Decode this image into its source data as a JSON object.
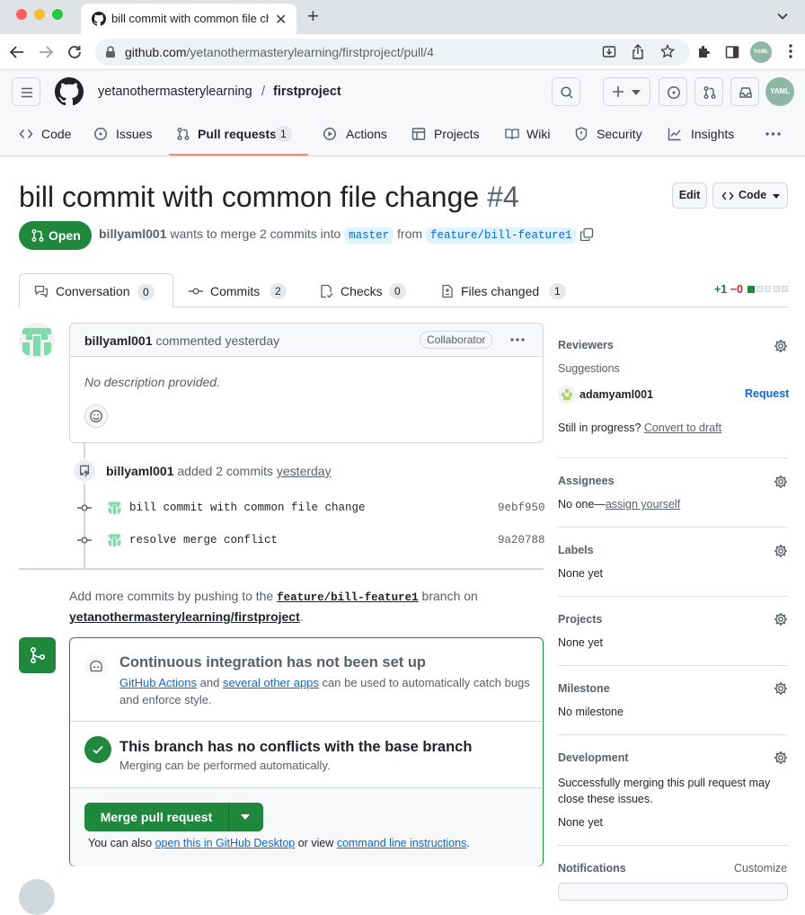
{
  "browser": {
    "tab_title": "bill commit with common file change",
    "url_host": "github.com",
    "url_path": "/yetanothermasterylearning/firstproject/pull/4",
    "profile_initials": "YAML"
  },
  "header": {
    "owner": "yetanothermasterylearning",
    "separator": "/",
    "repo": "firstproject",
    "avatar_initials": "YAML"
  },
  "repo_nav": [
    {
      "label": "Code"
    },
    {
      "label": "Issues"
    },
    {
      "label": "Pull requests",
      "count": "1"
    },
    {
      "label": "Actions"
    },
    {
      "label": "Projects"
    },
    {
      "label": "Wiki"
    },
    {
      "label": "Security"
    },
    {
      "label": "Insights"
    }
  ],
  "pr": {
    "title": "bill commit with common file change",
    "number": "#4",
    "edit_label": "Edit",
    "code_label": "Code",
    "state": "Open",
    "author": "billyaml001",
    "summary_mid": "wants to merge 2 commits into",
    "base_branch": "master",
    "from_word": "from",
    "head_branch": "feature/bill-feature1"
  },
  "pr_tabs": [
    {
      "label": "Conversation",
      "count": "0"
    },
    {
      "label": "Commits",
      "count": "2"
    },
    {
      "label": "Checks",
      "count": "0"
    },
    {
      "label": "Files changed",
      "count": "1"
    }
  ],
  "diffstat": {
    "added": "+1",
    "removed": "−0"
  },
  "comment": {
    "author": "billyaml001",
    "action": "commented",
    "time": "yesterday",
    "badge": "Collaborator",
    "body": "No description provided."
  },
  "commit_event": {
    "author": "billyaml001",
    "action": "added 2 commits",
    "time": "yesterday"
  },
  "commits": [
    {
      "message": "bill commit with common file change",
      "sha": "9ebf950"
    },
    {
      "message": "resolve merge conflict",
      "sha": "9a20788"
    }
  ],
  "push_hint": {
    "pre": "Add more commits by pushing to the",
    "branch": "feature/bill-feature1",
    "mid": "branch on",
    "repo": "yetanothermasterylearning/firstproject",
    "end": "."
  },
  "merge_box": {
    "ci_title": "Continuous integration has not been set up",
    "ci_link1": "GitHub Actions",
    "ci_and": "and",
    "ci_link2": "several other apps",
    "ci_text": "can be used to automatically catch bugs and enforce style.",
    "conflict_title": "This branch has no conflicts with the base branch",
    "conflict_sub": "Merging can be performed automatically.",
    "merge_button": "Merge pull request",
    "also_pre": "You can also",
    "also_link1": "open this in GitHub Desktop",
    "also_mid": "or view",
    "also_link2": "command line instructions",
    "also_end": "."
  },
  "sidebar": {
    "reviewers_title": "Reviewers",
    "suggestions": "Suggestions",
    "suggested_user": "adamyaml001",
    "request": "Request",
    "still_in_progress": "Still in progress?",
    "convert_to_draft": "Convert to draft",
    "assignees_title": "Assignees",
    "assignees_none": "No one—",
    "assign_yourself": "assign yourself",
    "labels_title": "Labels",
    "labels_value": "None yet",
    "projects_title": "Projects",
    "projects_value": "None yet",
    "milestone_title": "Milestone",
    "milestone_value": "No milestone",
    "development_title": "Development",
    "development_text": "Successfully merging this pull request may close these issues.",
    "development_value": "None yet",
    "notifications_title": "Notifications",
    "customize": "Customize"
  },
  "colors": {
    "open_green": "#1f883d",
    "link_blue": "#0969da",
    "active_tab_orange": "#fd8c73",
    "add_green": "#1a7f37",
    "del_red": "#cf222e"
  }
}
